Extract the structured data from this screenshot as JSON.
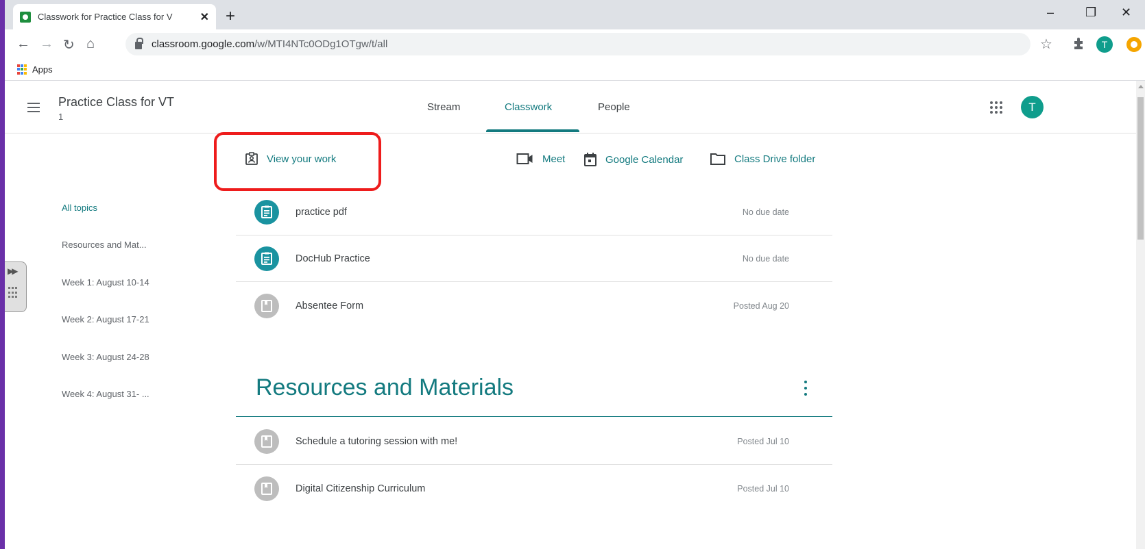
{
  "browser": {
    "tab_title": "Classwork for Practice Class for V",
    "tab_close": "✕",
    "new_tab": "+",
    "url_host": "classroom.google.com",
    "url_path": "/w/MTI4NTc0ODg1OTgw/t/all",
    "bookmarks_apps": "Apps",
    "profile_initial": "T",
    "window_controls": [
      "–",
      "❐",
      "✕"
    ]
  },
  "header": {
    "class_title": "Practice Class for VT",
    "class_subtitle": "1",
    "tabs": [
      {
        "label": "Stream",
        "active": false
      },
      {
        "label": "Classwork",
        "active": true
      },
      {
        "label": "People",
        "active": false
      }
    ],
    "avatar_initial": "T"
  },
  "toolbar": {
    "view_your_work": "View your work",
    "meet": "Meet",
    "google_calendar": "Google Calendar",
    "class_drive_folder": "Class Drive folder"
  },
  "topics": [
    {
      "label": "All topics",
      "active": true
    },
    {
      "label": "Resources and Mat...",
      "active": false
    },
    {
      "label": "Week 1: August 10-14",
      "active": false
    },
    {
      "label": "Week 2: August 17-21",
      "active": false
    },
    {
      "label": "Week 3: August 24-28",
      "active": false
    },
    {
      "label": "Week 4: August 31- ...",
      "active": false
    }
  ],
  "items": [
    {
      "name": "practice pdf",
      "meta": "No due date",
      "type": "assignment"
    },
    {
      "name": "DocHub Practice",
      "meta": "No due date",
      "type": "assignment"
    },
    {
      "name": "Absentee Form",
      "meta": "Posted Aug 20",
      "type": "material"
    }
  ],
  "section": {
    "title": "Resources and Materials",
    "items": [
      {
        "name": "Schedule a tutoring session with me!",
        "meta": "Posted Jul 10",
        "type": "material"
      },
      {
        "name": "Digital Citizenship Curriculum",
        "meta": "Posted Jul 10",
        "type": "material"
      }
    ]
  },
  "colors": {
    "accent": "#137a7f",
    "highlight": "#ee1c1c",
    "background": "#6a30a8"
  }
}
